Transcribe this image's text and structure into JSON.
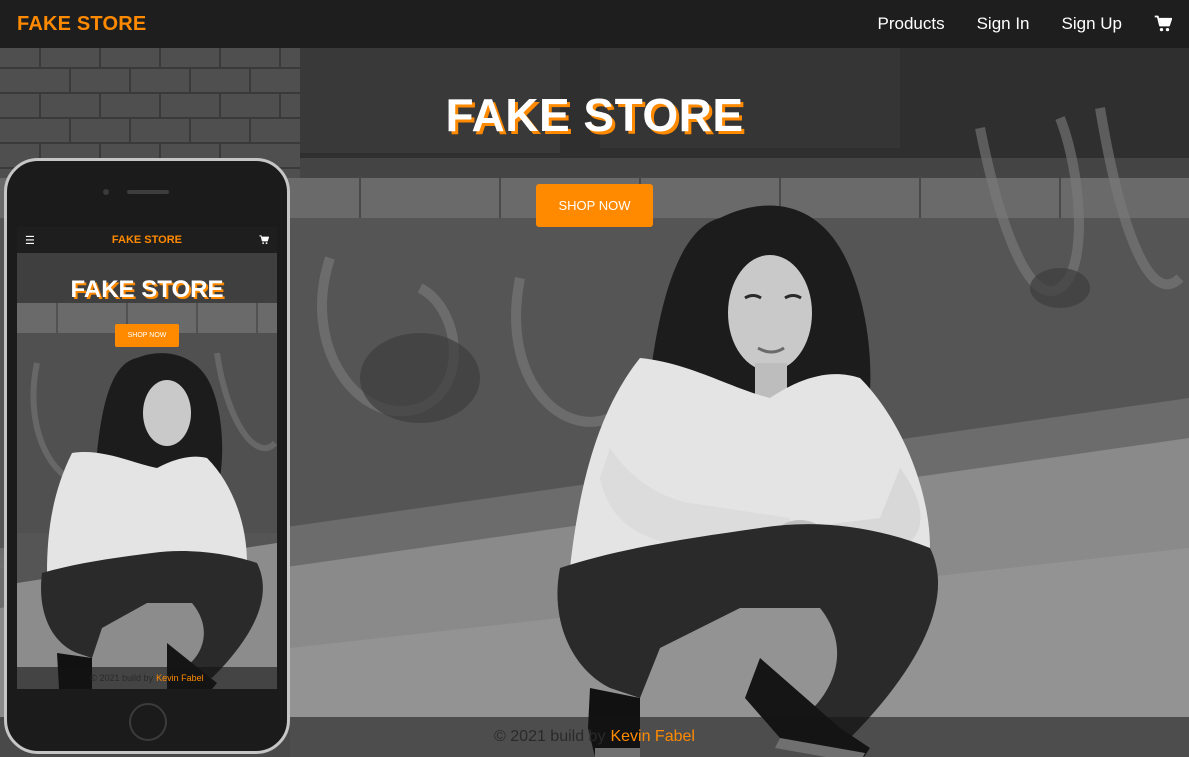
{
  "navbar": {
    "brand": "FAKE STORE",
    "links": {
      "products": "Products",
      "sign_in": "Sign In",
      "sign_up": "Sign Up"
    },
    "cart_icon": "shopping-cart-icon"
  },
  "hero": {
    "title": "FAKE STORE",
    "button": "SHOP NOW",
    "image": "woman-crouching-by-graffiti-wall-photo"
  },
  "footer": {
    "text": "© 2021 build by",
    "author": "Kevin Fabel"
  },
  "phone_preview": {
    "menu_icon": "hamburger-menu-icon",
    "brand": "FAKE STORE",
    "cart_icon": "shopping-cart-icon",
    "title": "FAKE STORE",
    "button": "SHOP NOW",
    "footer_text": "© 2021 build by",
    "footer_author": "Kevin Fabel"
  },
  "colors": {
    "accent": "#ff8a00",
    "navbar": "#1e1e1e",
    "text_light": "#ffffff"
  }
}
